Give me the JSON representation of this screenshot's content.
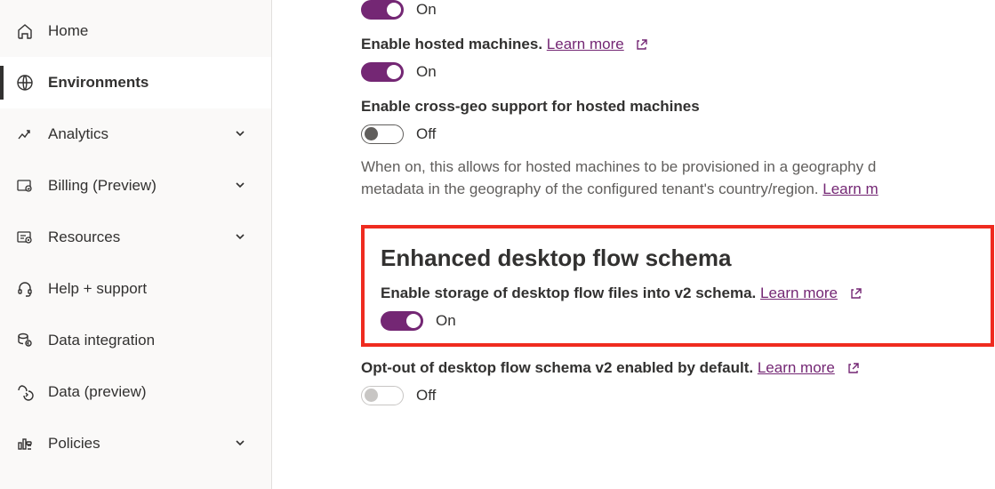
{
  "sidebar": {
    "items": [
      {
        "label": "Home"
      },
      {
        "label": "Environments"
      },
      {
        "label": "Analytics"
      },
      {
        "label": "Billing (Preview)"
      },
      {
        "label": "Resources"
      },
      {
        "label": "Help + support"
      },
      {
        "label": "Data integration"
      },
      {
        "label": "Data (preview)"
      },
      {
        "label": "Policies"
      }
    ]
  },
  "settings": {
    "toggle1": {
      "state": "On"
    },
    "hostedMachines": {
      "label_prefix": "Enable hosted machines. ",
      "learn_more": "Learn more",
      "state": "On"
    },
    "crossGeo": {
      "label": "Enable cross-geo support for hosted machines",
      "state": "Off",
      "desc_line1": "When on, this allows for hosted machines to be provisioned in a geography d",
      "desc_line2_prefix": "metadata in the geography of the configured tenant's country/region. ",
      "desc_line2_link": "Learn m"
    },
    "enhancedSchema": {
      "title": "Enhanced desktop flow schema",
      "label_prefix": "Enable storage of desktop flow files into v2 schema. ",
      "learn_more": "Learn more",
      "state": "On"
    },
    "optOut": {
      "label_prefix": "Opt-out of desktop flow schema v2 enabled by default. ",
      "learn_more": "Learn more",
      "state": "Off"
    }
  }
}
